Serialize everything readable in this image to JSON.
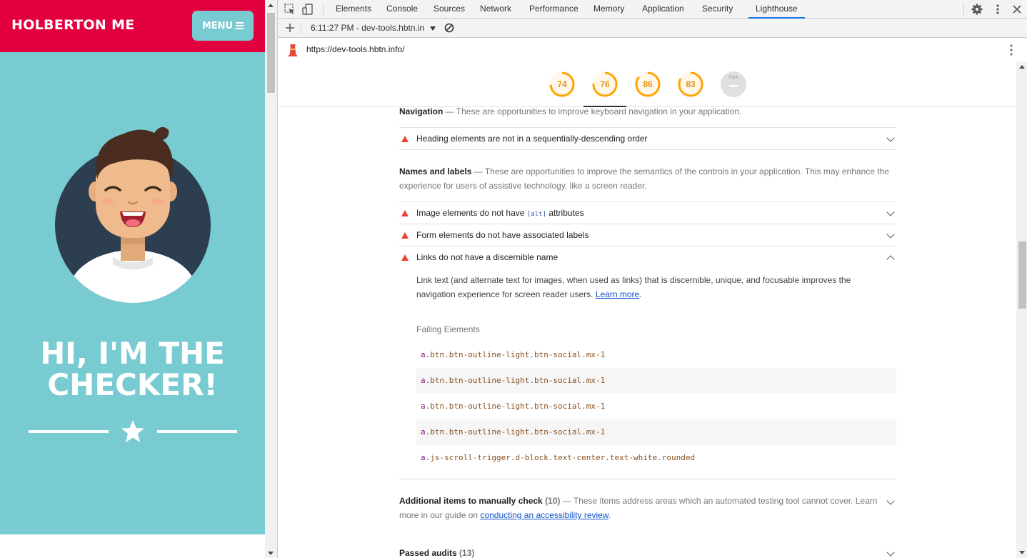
{
  "site": {
    "brand": "HOLBERTON ME",
    "menu_label": "MENU",
    "hero_title": "HI, I'M THE\nCHECKER!",
    "colors": {
      "header": "#e3003e",
      "hero": "#79cbd2",
      "menu_button": "#79cbd2"
    }
  },
  "devtools": {
    "tabs": [
      "Elements",
      "Console",
      "Sources",
      "Network",
      "Performance",
      "Memory",
      "Application",
      "Security",
      "Lighthouse"
    ],
    "active_tab": "Lighthouse",
    "report_selector": "6:11:27 PM - dev-tools.hbtn.in",
    "url": "https://dev-tools.hbtn.info/",
    "scores": [
      {
        "value": "74",
        "fraction": 0.74
      },
      {
        "value": "76",
        "fraction": 0.76
      },
      {
        "value": "86",
        "fraction": 0.86
      },
      {
        "value": "83",
        "fraction": 0.83
      },
      {
        "value": "PWA",
        "fraction": 0
      }
    ],
    "score_color": "#ffa400"
  },
  "report": {
    "navigation": {
      "title": "Navigation",
      "description": "These are opportunities to improve keyboard navigation in your application.",
      "audits": [
        "Heading elements are not in a sequentially-descending order"
      ]
    },
    "names_labels": {
      "title": "Names and labels",
      "description": "These are opportunities to improve the semantics of the controls in your application. This may enhance the experience for users of assistive technology, like a screen reader.",
      "audit_image_prefix": "Image elements do not have",
      "audit_image_code": "[alt]",
      "audit_image_suffix": "attributes",
      "audit_form": "Form elements do not have associated labels",
      "audit_links": "Links do not have a discernible name",
      "links_description": "Link text (and alternate text for images, when used as links) that is discernible, unique, and focusable improves the navigation experience for screen reader users.",
      "learn_more": "Learn more",
      "failing_label": "Failing Elements",
      "failing_elements": [
        {
          "tag": "a",
          "rest": ".btn.btn-outline-light.btn-social.mx-1"
        },
        {
          "tag": "a",
          "rest": ".btn.btn-outline-light.btn-social.mx-1"
        },
        {
          "tag": "a",
          "rest": ".btn.btn-outline-light.btn-social.mx-1"
        },
        {
          "tag": "a",
          "rest": ".btn.btn-outline-light.btn-social.mx-1"
        },
        {
          "tag": "a",
          "rest": ".js-scroll-trigger.d-block.text-center.text-white.rounded"
        }
      ]
    },
    "manual": {
      "title": "Additional items to manually check",
      "count": "(10)",
      "description_prefix": "These items address areas which an automated testing tool cannot cover. Learn more in our guide on",
      "link": "conducting an accessibility review",
      "description_suffix": "."
    },
    "passed": {
      "title": "Passed audits",
      "count": "(13)"
    }
  }
}
